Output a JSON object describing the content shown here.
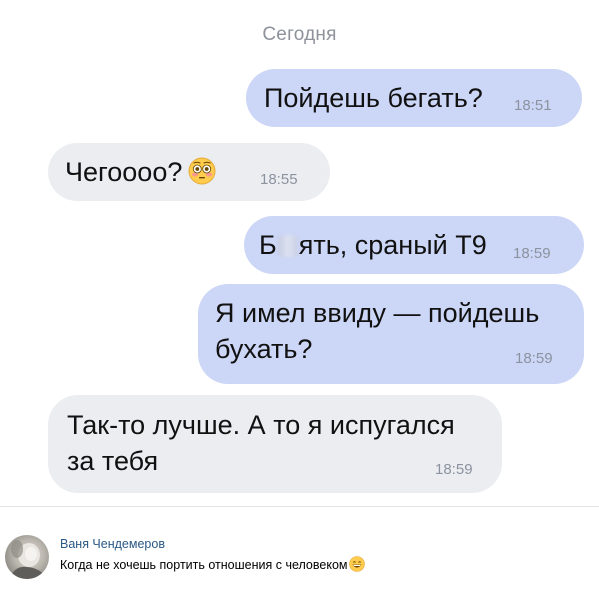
{
  "chat": {
    "date_separator": "Сегодня",
    "messages": [
      {
        "direction": "outgoing",
        "text": "Пойдешь бегать?",
        "time": "18:51"
      },
      {
        "direction": "incoming",
        "text": "Чегоооо?",
        "emoji": "flushed-face-emoji",
        "time": "18:55"
      },
      {
        "direction": "outgoing",
        "text_start": "Б",
        "text_censored": "**",
        "text_end": "ять, сраный Т9",
        "time": "18:59"
      },
      {
        "direction": "outgoing",
        "lines": [
          "Я имел ввиду — пойдешь",
          "бухать?"
        ],
        "time": "18:59"
      },
      {
        "direction": "incoming",
        "lines": [
          "Так-то лучше. А то я испугался",
          "за тебя"
        ],
        "time": "18:59"
      }
    ],
    "colors": {
      "outgoing_bubble": "#ccd6f6",
      "incoming_bubble": "#ebedf0",
      "timestamp": "#8c93a0",
      "date_separator": "#8d929b"
    }
  },
  "comment": {
    "author": "Ваня Чендемеров",
    "text": "Когда не хочешь портить отношения с человеком",
    "emoji": "grinning-face-emoji",
    "author_color": "#2a5885"
  }
}
